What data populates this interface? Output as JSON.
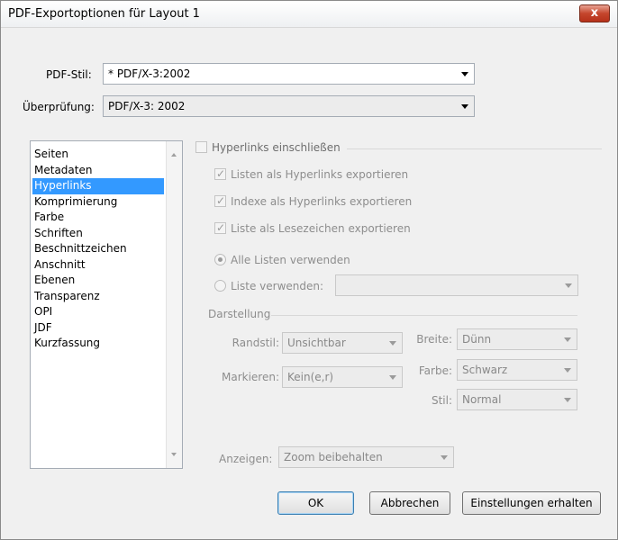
{
  "window": {
    "title": "PDF-Exportoptionen für Layout 1",
    "close_label": "x"
  },
  "pdf_style": {
    "label": "PDF-Stil:",
    "value": "* PDF/X-3:2002"
  },
  "validation": {
    "label": "Überprüfung:",
    "value": "PDF/X-3: 2002"
  },
  "nav": {
    "items": [
      {
        "label": "Seiten",
        "selected": false
      },
      {
        "label": "Metadaten",
        "selected": false
      },
      {
        "label": "Hyperlinks",
        "selected": true
      },
      {
        "label": "Komprimierung",
        "selected": false
      },
      {
        "label": "Farbe",
        "selected": false
      },
      {
        "label": "Schriften",
        "selected": false
      },
      {
        "label": "Beschnittzeichen",
        "selected": false
      },
      {
        "label": "Anschnitt",
        "selected": false
      },
      {
        "label": "Ebenen",
        "selected": false
      },
      {
        "label": "Transparenz",
        "selected": false
      },
      {
        "label": "OPI",
        "selected": false
      },
      {
        "label": "JDF",
        "selected": false
      },
      {
        "label": "Kurzfassung",
        "selected": false
      }
    ]
  },
  "hyperlinks": {
    "include_label": "Hyperlinks einschließen",
    "include_checked": false,
    "lists_as_links": {
      "label": "Listen als Hyperlinks exportieren",
      "checked": true
    },
    "indexes_as_links": {
      "label": "Indexe als Hyperlinks exportieren",
      "checked": true
    },
    "list_as_bookmarks": {
      "label": "Liste als Lesezeichen exportieren",
      "checked": true
    },
    "all_lists": {
      "label": "Alle Listen verwenden",
      "selected": true
    },
    "use_list": {
      "label": "Liste verwenden:",
      "selected": false,
      "value": ""
    }
  },
  "appearance": {
    "section_label": "Darstellung",
    "border_style": {
      "label": "Randstil:",
      "value": "Unsichtbar"
    },
    "width": {
      "label": "Breite:",
      "value": "Dünn"
    },
    "highlight": {
      "label": "Markieren:",
      "value": "Kein(e,r)"
    },
    "color": {
      "label": "Farbe:",
      "value": "Schwarz"
    },
    "style": {
      "label": "Stil:",
      "value": "Normal"
    }
  },
  "display": {
    "label": "Anzeigen:",
    "value": "Zoom beibehalten"
  },
  "buttons": {
    "ok": "OK",
    "cancel": "Abbrechen",
    "keep_settings": "Einstellungen erhalten"
  }
}
